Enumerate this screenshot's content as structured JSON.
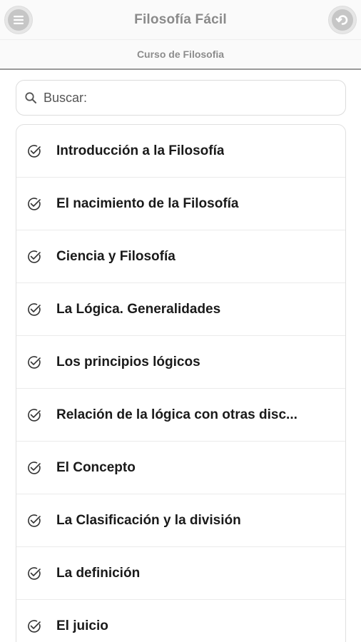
{
  "header": {
    "title": "Filosofía Fácil",
    "left_icon": "menu-icon",
    "right_icon": "back-icon"
  },
  "subheader": {
    "title": "Curso de Filosofia"
  },
  "search": {
    "placeholder": "Buscar:",
    "icon": "search-icon"
  },
  "lessons": [
    {
      "label": "Introducción a la Filosofía",
      "icon": "check-circle-icon"
    },
    {
      "label": "El nacimiento de la Filosofía",
      "icon": "check-circle-icon"
    },
    {
      "label": "Ciencia y Filosofía",
      "icon": "check-circle-icon"
    },
    {
      "label": "La Lógica. Generalidades",
      "icon": "check-circle-icon"
    },
    {
      "label": "Los principios lógicos",
      "icon": "check-circle-icon"
    },
    {
      "label": "Relación de la lógica con otras disc...",
      "icon": "check-circle-icon"
    },
    {
      "label": "El Concepto",
      "icon": "check-circle-icon"
    },
    {
      "label": "La Clasificación y la división",
      "icon": "check-circle-icon"
    },
    {
      "label": "La definición",
      "icon": "check-circle-icon"
    },
    {
      "label": "El juicio",
      "icon": "check-circle-icon"
    }
  ],
  "colors": {
    "header_text": "#8a8a8a",
    "item_text": "#1a1a1a",
    "divider": "#9a9a9a"
  }
}
